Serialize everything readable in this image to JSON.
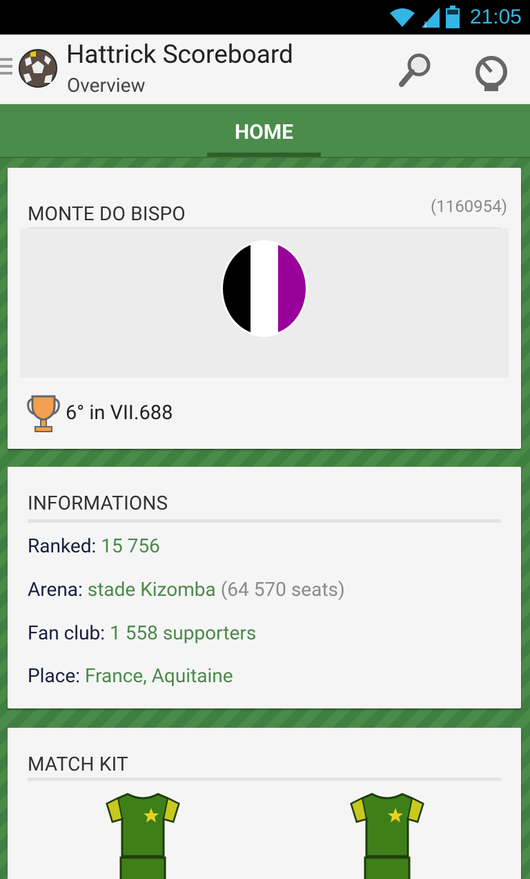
{
  "status_bar": {
    "time": "21:05"
  },
  "action_bar": {
    "title": "Hattrick Scoreboard",
    "subtitle": "Overview",
    "actions": [
      "search-icon",
      "dial-icon"
    ]
  },
  "tabs": [
    {
      "label": "HOME",
      "selected": true
    }
  ],
  "team_card": {
    "name": "MONTE DO BISPO",
    "id": "(1160954)",
    "crest_colors": [
      "#000000",
      "#ffffff",
      "#990099"
    ],
    "league": "6° in VII.688"
  },
  "info_card": {
    "title": "INFORMATIONS",
    "ranked": {
      "label": "Ranked:",
      "value": "15 756"
    },
    "arena": {
      "label": "Arena:",
      "value": "stade Kizomba",
      "extra": "(64 570 seats)"
    },
    "fan_club": {
      "label": "Fan club:",
      "value": "1 558 supporters"
    },
    "place": {
      "label": "Place:",
      "value": "France, Aquitaine"
    }
  },
  "kit_card": {
    "title": "MATCH KIT",
    "kits": [
      {
        "shirt": "#3f7f1a",
        "sleeves": "#c8c81e",
        "star": "#e6d21e"
      },
      {
        "shirt": "#3f7f1a",
        "sleeves": "#c8c81e",
        "star": "#e6d21e"
      }
    ]
  },
  "colors": {
    "accent_green": "#4a8a4a",
    "tab_bar": "#4b8b4b",
    "clock": "#33b5e5"
  }
}
